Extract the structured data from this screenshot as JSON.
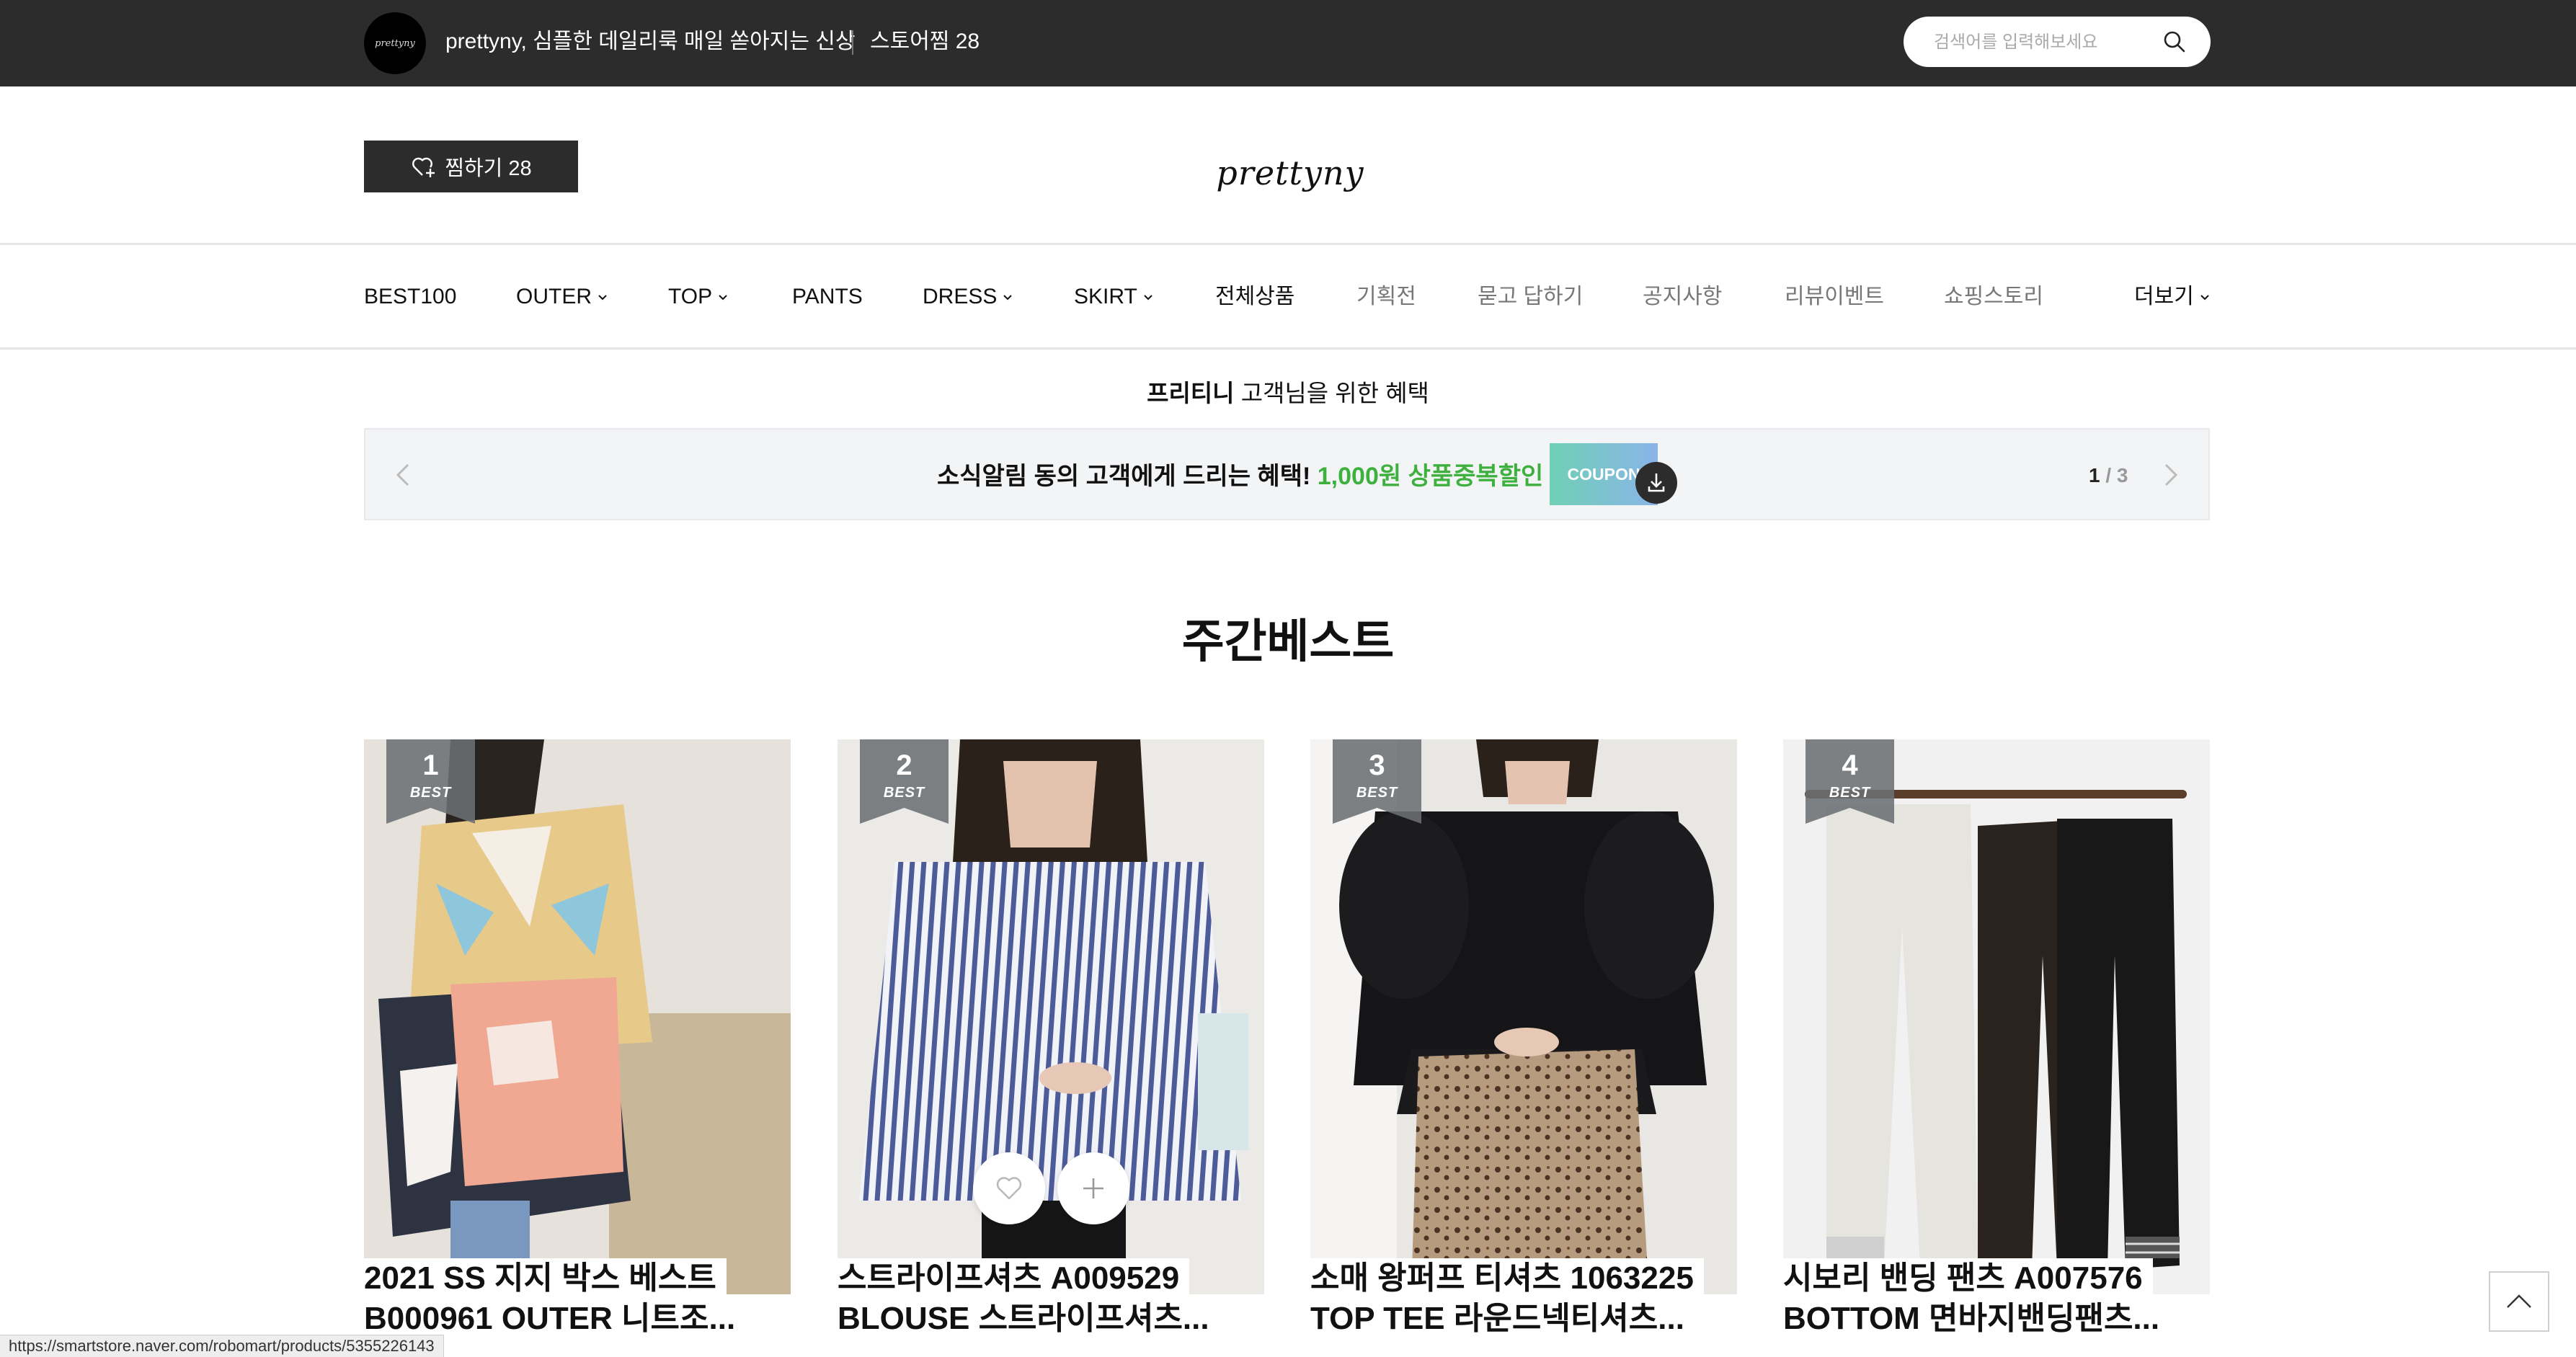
{
  "topbar": {
    "store_logo_text": "prettyny",
    "title": "prettyny, 심플한 데일리룩 매일 쏟아지는 신상",
    "store_zzim": "스토어찜 28",
    "search_placeholder": "검색어를 입력해보세요"
  },
  "header": {
    "zzim_label": "찜하기 28",
    "brand": "prettyny"
  },
  "nav": {
    "items": [
      {
        "label": "BEST100"
      },
      {
        "label": "OUTER"
      },
      {
        "label": "TOP"
      },
      {
        "label": "PANTS"
      },
      {
        "label": "DRESS"
      },
      {
        "label": "SKIRT"
      },
      {
        "label": "전체상품"
      },
      {
        "label": "기획전"
      },
      {
        "label": "묻고 답하기"
      },
      {
        "label": "공지사항"
      },
      {
        "label": "리뷰이벤트"
      },
      {
        "label": "쇼핑스토리"
      }
    ],
    "more": "더보기"
  },
  "benefit": {
    "title_bold": "프리티니",
    "title_rest": " 고객님을 위한 혜택",
    "banner_text": "소식알림 동의 고객에게 드리는 혜택!",
    "banner_highlight": "1,000원 상품중복할인",
    "coupon_label": "COUPON",
    "page_current": "1",
    "page_sep": " / ",
    "page_total": "3",
    "highlight_color": "#3db03d"
  },
  "weekly_best": {
    "title": "주간베스트",
    "badge_label": "BEST",
    "products": [
      {
        "rank": "1",
        "line1": "2021 SS 지지 박스 베스트",
        "line2": "B000961 OUTER 니트조..."
      },
      {
        "rank": "2",
        "line1": "스트라이프셔츠 A009529",
        "line2": "BLOUSE 스트라이프셔츠..."
      },
      {
        "rank": "3",
        "line1": "소매 왕퍼프 티셔츠 1063225",
        "line2": "TOP TEE 라운드넥티셔츠..."
      },
      {
        "rank": "4",
        "line1": "시보리 밴딩 팬츠 A007576",
        "line2": "BOTTOM 면바지밴딩팬츠..."
      }
    ]
  },
  "status_url": "https://smartstore.naver.com/robomart/products/5355226143"
}
